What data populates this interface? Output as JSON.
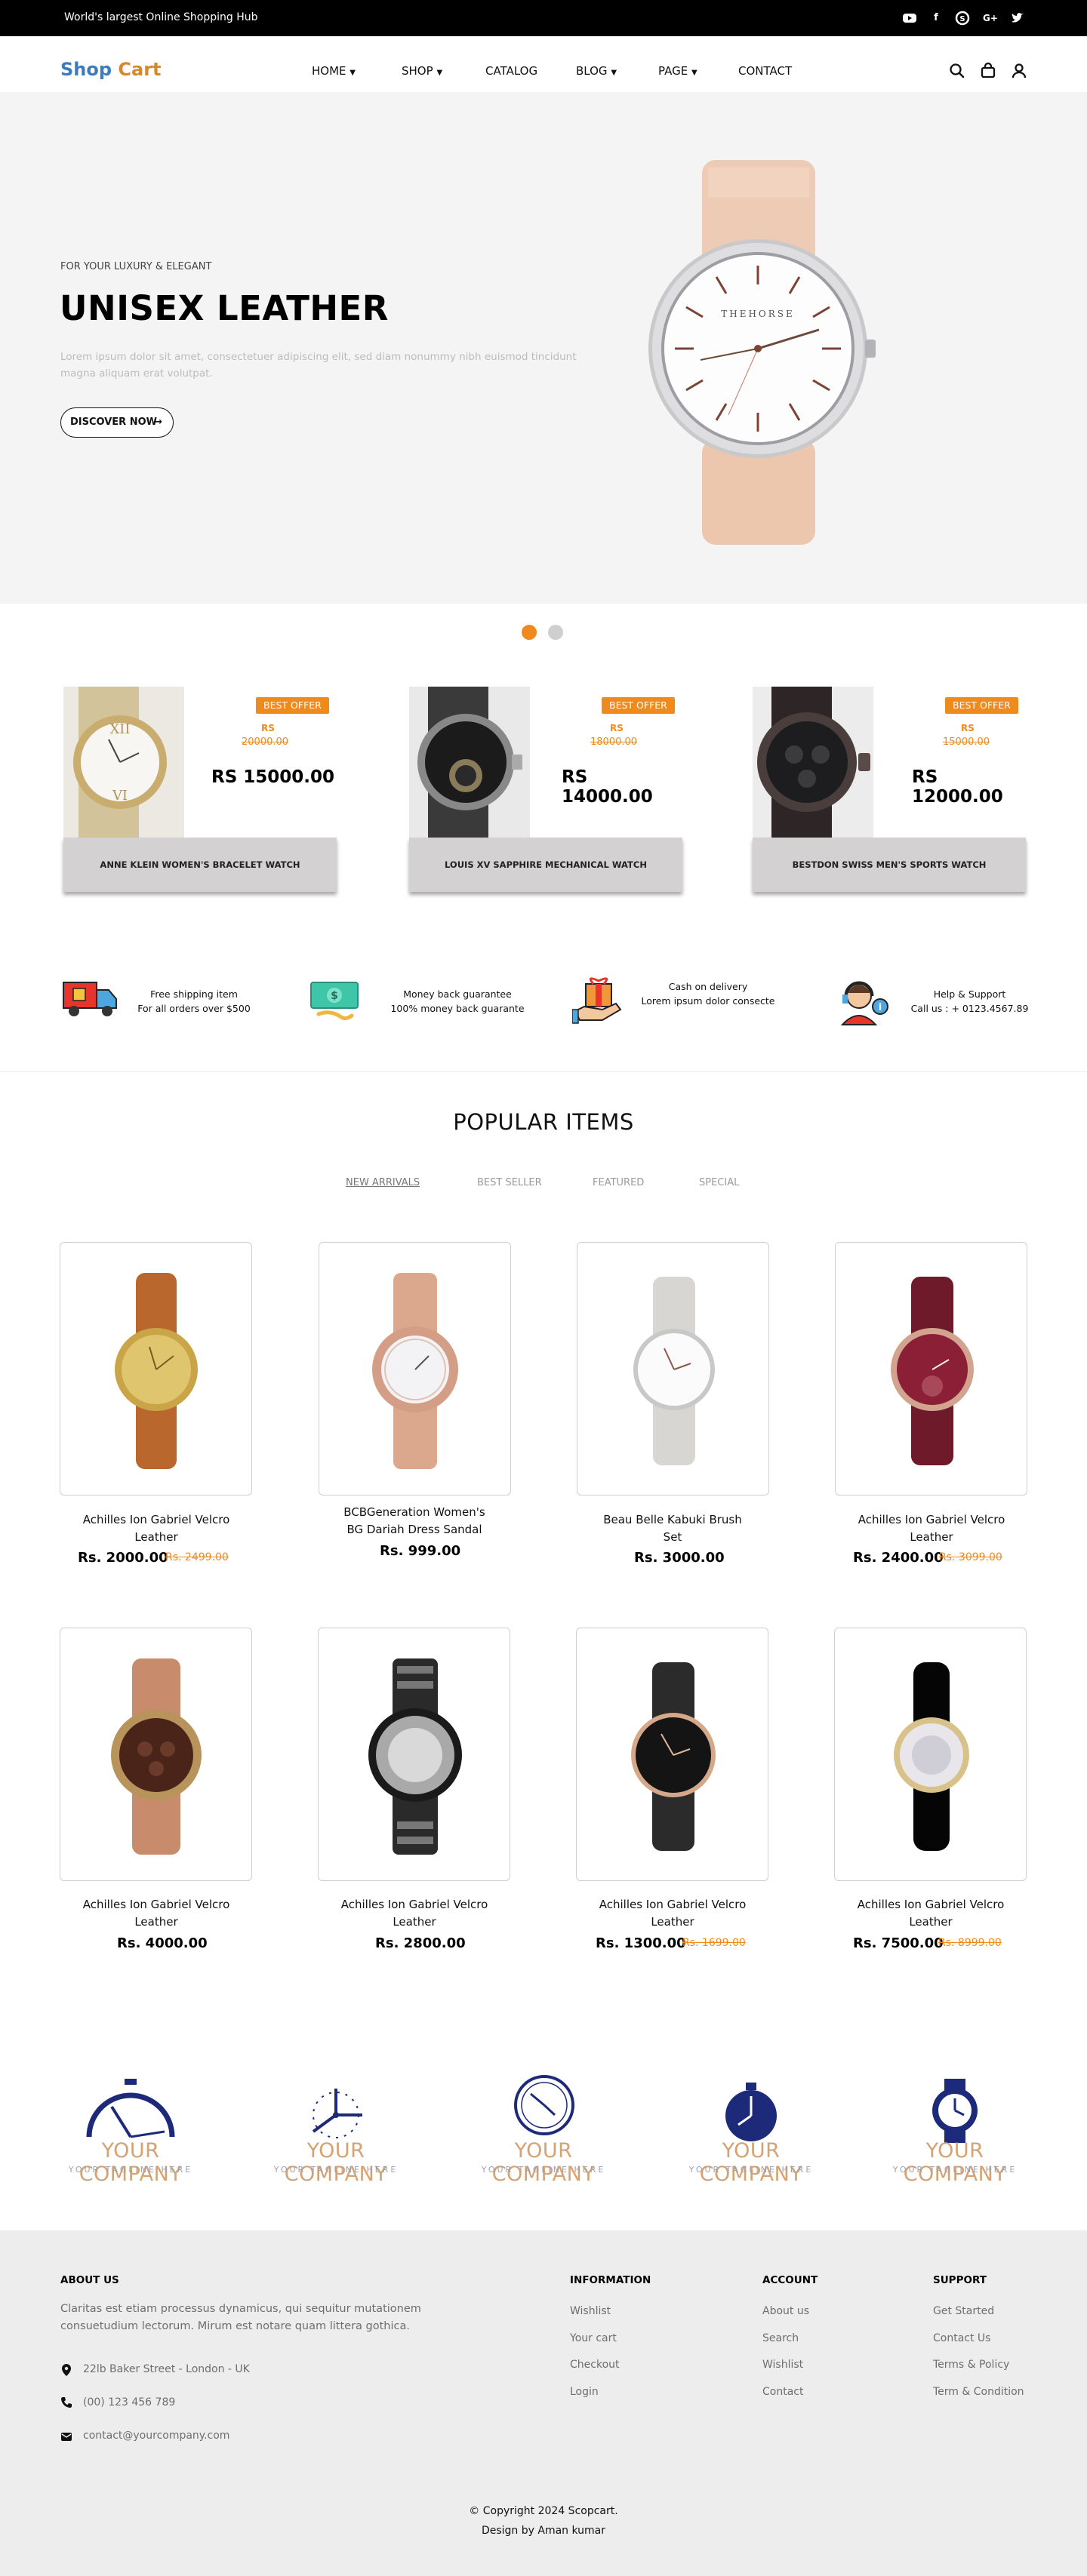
{
  "topbar": {
    "tagline": "World's largest Online Shopping Hub",
    "social_icons": [
      "youtube-icon",
      "facebook-icon",
      "skype-icon",
      "google-plus-icon",
      "twitter-icon"
    ]
  },
  "header": {
    "logo_part1": "Shop",
    "logo_part2": "Cart",
    "nav": [
      "HOME",
      "SHOP",
      "CATALOG",
      "BLOG",
      "PAGE",
      "CONTACT"
    ],
    "icons": [
      "search-icon",
      "bag-icon",
      "user-icon"
    ]
  },
  "hero": {
    "eyebrow": "FOR YOUR LUXURY & ELEGANT",
    "title": "UNISEX LEATHER",
    "description": "Lorem ipsum dolor sit amet, consectetuer adipiscing elit, sed diam nonummy nibh euismod tincidunt magna aliquam erat volutpat.",
    "button_label": "DISCOVER NOW",
    "watch_brand": "THEHORSE"
  },
  "offers": [
    {
      "badge": "BEST OFFER",
      "currency": "RS",
      "old_price": "20000.00",
      "price": "RS 15000.00",
      "name": "ANNE KLEIN WOMEN'S BRACELET WATCH"
    },
    {
      "badge": "BEST OFFER",
      "currency": "RS",
      "old_price": "18000.00",
      "price": "RS 14000.00",
      "name": "LOUIS XV SAPPHIRE MECHANICAL WATCH"
    },
    {
      "badge": "BEST OFFER",
      "currency": "RS",
      "old_price": "15000.00",
      "price": "RS 12000.00",
      "name": "BESTDON SWISS MEN'S SPORTS WATCH"
    }
  ],
  "features": [
    {
      "line1": "Free shipping item",
      "line2": "For all orders over $500",
      "icon": "truck-icon"
    },
    {
      "line1": "Money back guarantee",
      "line2": "100% money back guarante",
      "icon": "money-icon"
    },
    {
      "line1": "Cash on delivery",
      "line2": "Lorem ipsum dolor consecte",
      "icon": "gift-icon"
    },
    {
      "line1": "Help & Support",
      "line2": "Call us : + 0123.4567.89",
      "icon": "support-icon"
    }
  ],
  "popular": {
    "title": "POPULAR ITEMS",
    "tabs": [
      "NEW ARRIVALS",
      "BEST SELLER",
      "FEATURED",
      "SPECIAL"
    ],
    "active_tab": "NEW ARRIVALS",
    "products": [
      {
        "name_line1": "Achilles Ion Gabriel Velcro",
        "name_line2": "Leather",
        "price": "Rs. 2000.00",
        "old_price": "Rs. 2499.00"
      },
      {
        "name_line1": "BCBGeneration Women's",
        "name_line2": "BG Dariah Dress Sandal",
        "price": "Rs. 999.00",
        "old_price": ""
      },
      {
        "name_line1": "Beau Belle Kabuki Brush",
        "name_line2": "Set",
        "price": "Rs. 3000.00",
        "old_price": ""
      },
      {
        "name_line1": "Achilles Ion Gabriel Velcro",
        "name_line2": "Leather",
        "price": "Rs. 2400.00",
        "old_price": "Rs. 3099.00"
      },
      {
        "name_line1": "Achilles Ion Gabriel Velcro",
        "name_line2": "Leather",
        "price": "Rs. 4000.00",
        "old_price": ""
      },
      {
        "name_line1": "Achilles Ion Gabriel Velcro",
        "name_line2": "Leather",
        "price": "Rs. 2800.00",
        "old_price": ""
      },
      {
        "name_line1": "Achilles Ion Gabriel Velcro",
        "name_line2": "Leather",
        "price": "Rs. 1300.00",
        "old_price": "Rs. 1699.00"
      },
      {
        "name_line1": "Achilles Ion Gabriel Velcro",
        "name_line2": "Leather",
        "price": "Rs. 7500.00",
        "old_price": "Rs. 8999.00"
      }
    ]
  },
  "brands": {
    "company": "YOUR COMPANY",
    "tagline": "YOUR TAGLINE HERE"
  },
  "footer": {
    "about_title": "ABOUT US",
    "about_text_line1": "Claritas est etiam processus dynamicus, qui sequitur mutationem",
    "about_text_line2": "consuetudium lectorum. Mirum est notare quam littera gothica.",
    "address": "22lb Baker Street - London - UK",
    "phone": "(00) 123 456 789",
    "email": "contact@yourcompany.com",
    "columns": [
      {
        "title": "INFORMATION",
        "links": [
          "Wishlist",
          "Your cart",
          "Checkout",
          "Login"
        ]
      },
      {
        "title": "ACCOUNT",
        "links": [
          "About us",
          "Search",
          "Wishlist",
          "Contact"
        ]
      },
      {
        "title": "SUPPORT",
        "links": [
          "Get Started",
          "Contact Us",
          "Terms & Policy",
          "Term & Condition"
        ]
      }
    ],
    "copyright": "© Copyright 2024 Scopcart.",
    "credit": "Design by Aman kumar"
  },
  "colors": {
    "accent_orange": "#f08a1c",
    "logo_blue": "#3d7bbd",
    "logo_orange": "#d6892c",
    "brand_navy": "#1d2a7a"
  }
}
